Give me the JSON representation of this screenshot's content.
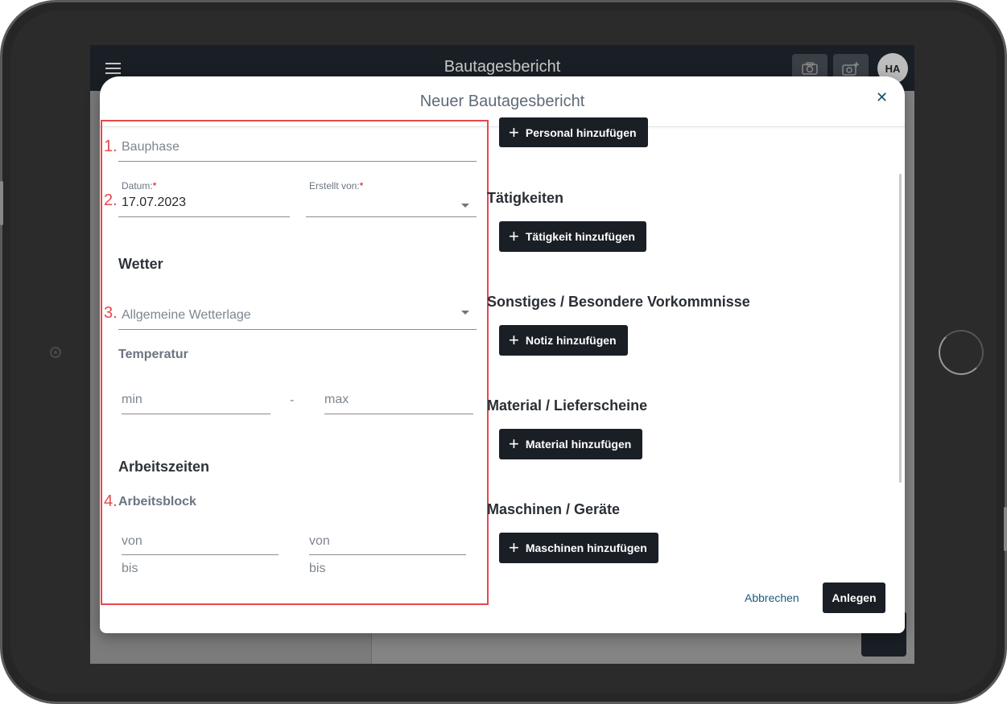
{
  "app": {
    "title": "Bautagesbericht",
    "avatar_initials": "HA"
  },
  "dialog": {
    "title": "Neuer Bautagesbericht",
    "close_icon": "close-icon"
  },
  "annotations": [
    "1.",
    "2.",
    "3.",
    "4."
  ],
  "form": {
    "bauphase_placeholder": "Bauphase",
    "datum_label": "Datum:",
    "datum_value": "17.07.2023",
    "erstellt_label": "Erstellt von:",
    "required_mark": "*",
    "wetter_heading": "Wetter",
    "wetterlage_placeholder": "Allgemeine Wetterlage",
    "temperatur_heading": "Temperatur",
    "temp_min_placeholder": "min",
    "temp_separator": "-",
    "temp_max_placeholder": "max",
    "arbeitszeiten_heading": "Arbeitszeiten",
    "arbeitsblock_heading": "Arbeitsblock",
    "block1_von": "von",
    "block1_bis": "bis",
    "block2_von": "von",
    "block2_bis": "bis"
  },
  "sections": {
    "personal_button": "Personal hinzufügen",
    "taetigkeiten_heading": "Tätigkeiten",
    "taetigkeit_button": "Tätigkeit hinzufügen",
    "sonstiges_heading": "Sonstiges / Besondere Vorkommnisse",
    "notiz_button": "Notiz hinzufügen",
    "material_heading": "Material / Lieferscheine",
    "material_button": "Material hinzufügen",
    "maschinen_heading": "Maschinen / Geräte",
    "maschinen_button": "Maschinen hinzufügen"
  },
  "footer": {
    "cancel_label": "Abbrechen",
    "create_label": "Anlegen"
  },
  "colors": {
    "primary_dark": "#1a1f26",
    "annotation_red": "#e5484d",
    "link_blue": "#1e5a7a"
  }
}
